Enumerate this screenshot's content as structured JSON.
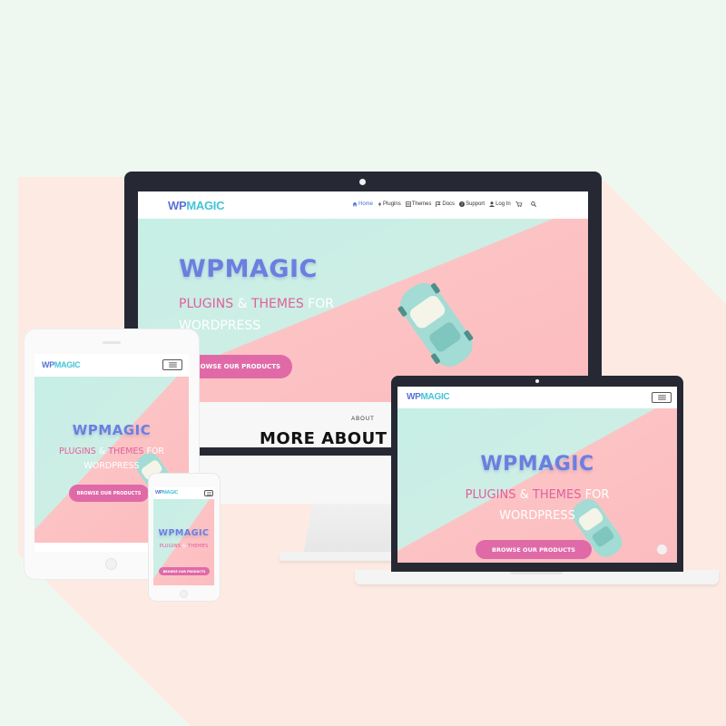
{
  "colors": {
    "background_mint": "#eff8f0",
    "background_peach": "#fdebe3",
    "logo_blue": "#5a72d6",
    "logo_cyan": "#45c3d7",
    "title_blue": "#6b7fe0",
    "accent_pink": "#e0609e",
    "button_pink": "#e06aa8",
    "nav_active": "#4a6fd0"
  },
  "logo": {
    "part1": "WP",
    "part2": "MAGIC"
  },
  "nav": {
    "items": [
      {
        "label": "Home",
        "icon": "home-icon"
      },
      {
        "label": "Plugins",
        "icon": "bolt-icon"
      },
      {
        "label": "Themes",
        "icon": "list-icon"
      },
      {
        "label": "Docs",
        "icon": "flag-icon"
      },
      {
        "label": "Support",
        "icon": "question-icon"
      },
      {
        "label": "Log In",
        "icon": "user-icon"
      }
    ],
    "cart_icon": "cart-icon",
    "search_icon": "search-icon",
    "menu_icon": "hamburger-icon"
  },
  "hero": {
    "title": "WPMAGIC",
    "subtitle_plugins": "PLUGINS",
    "subtitle_amp": "&",
    "subtitle_themes": "THEMES",
    "subtitle_for": "FOR",
    "subtitle_wordpress": "WORDPRESS",
    "button_label": "BROWSE OUR PRODUCTS",
    "button_icon": "circle-arrow-icon"
  },
  "about": {
    "label": "ABOUT",
    "heading": "MORE ABOUT W"
  }
}
